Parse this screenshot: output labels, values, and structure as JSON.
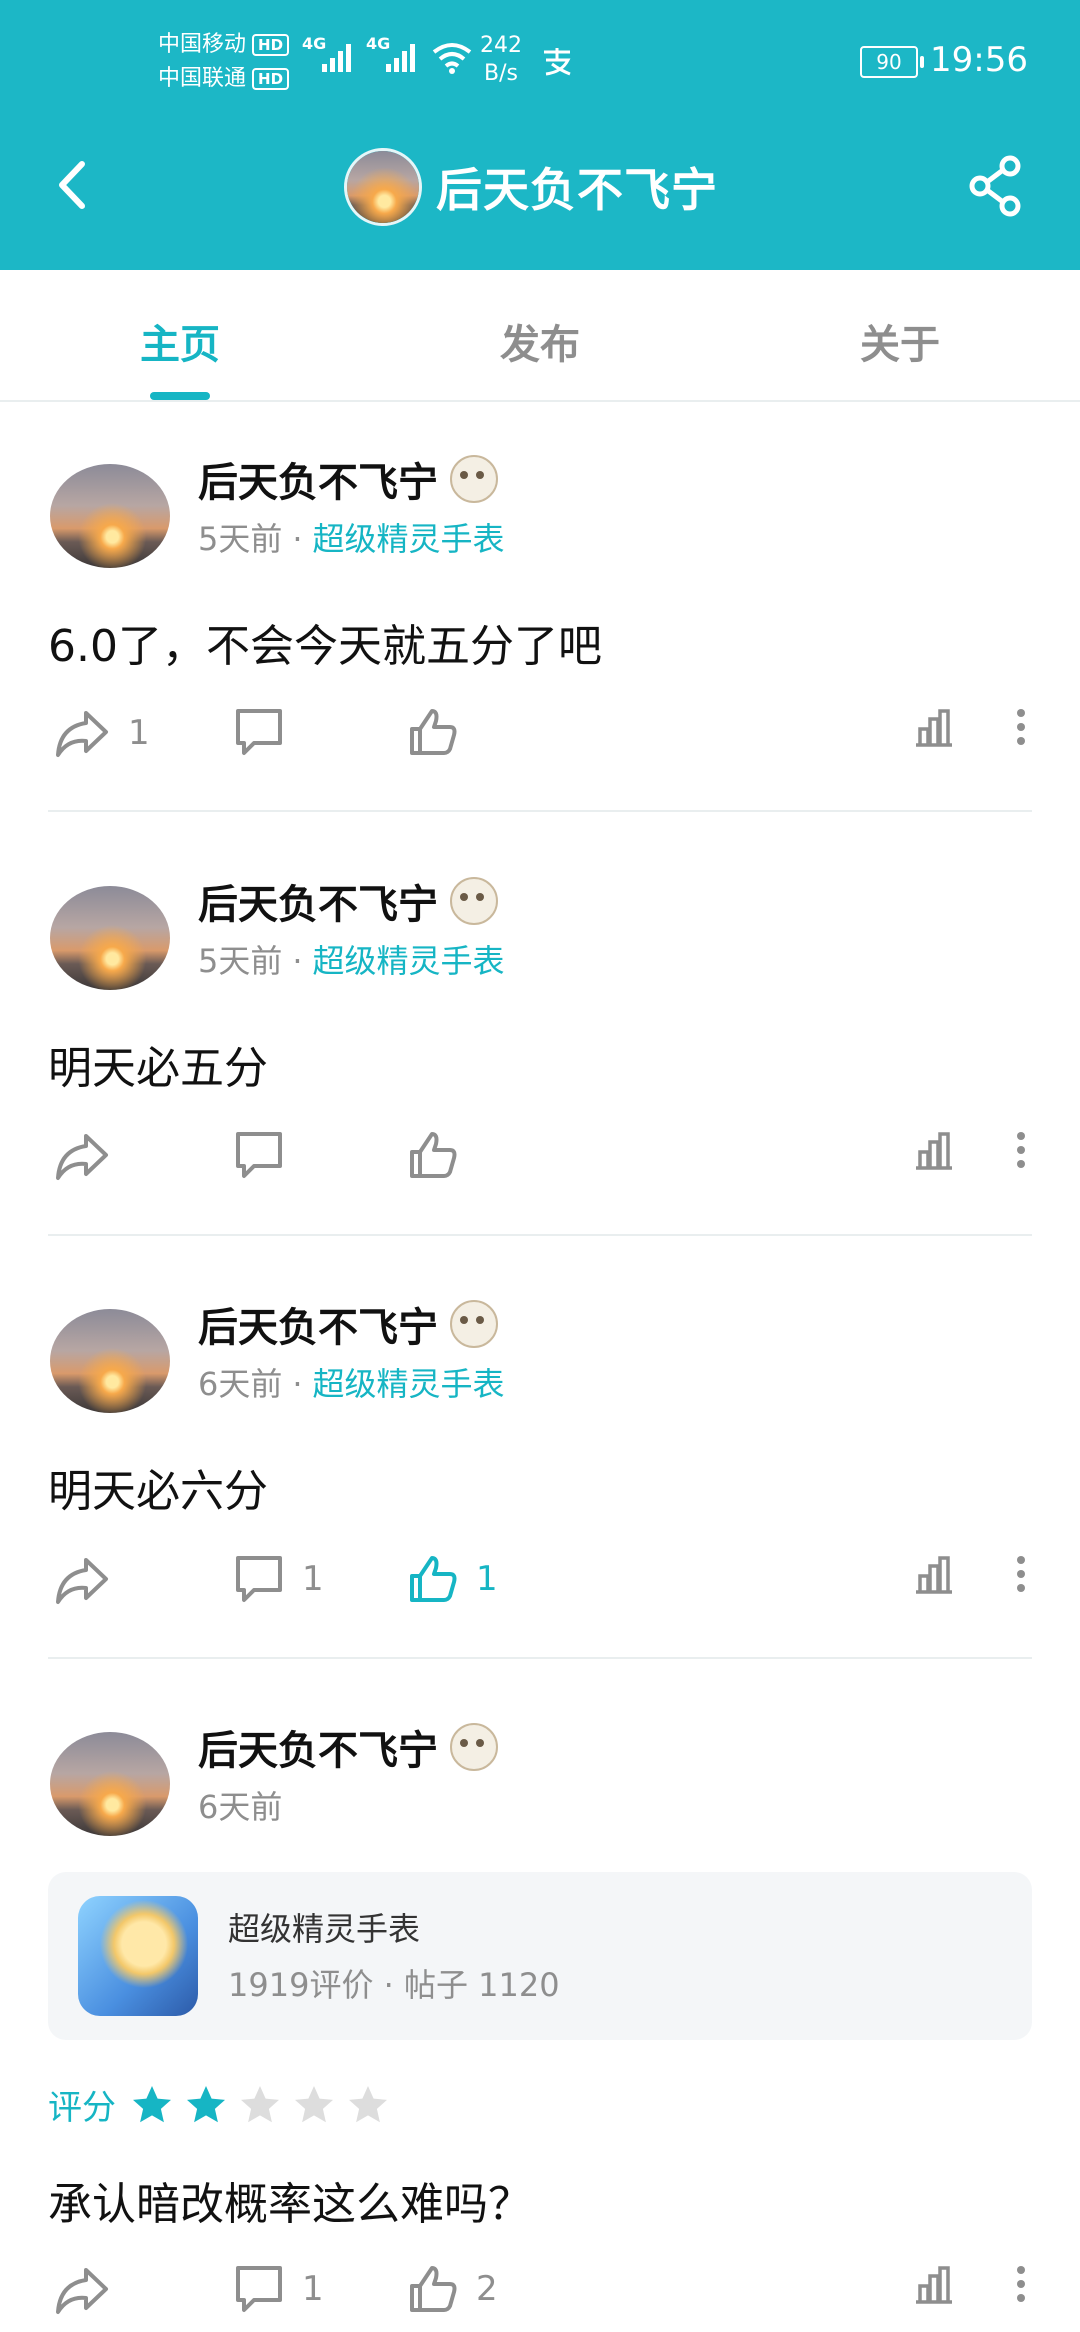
{
  "status_bar": {
    "carrier1": "中国移动",
    "carrier2": "中国联通",
    "hd_badge": "HD",
    "signal_type": "4G",
    "net_speed_value": "242",
    "net_speed_unit": "B/s",
    "battery": "90",
    "time": "19:56"
  },
  "header": {
    "title": "后天负不飞宁"
  },
  "tabs": [
    {
      "label": "主页",
      "active": true
    },
    {
      "label": "发布",
      "active": false
    },
    {
      "label": "关于",
      "active": false
    }
  ],
  "posts": [
    {
      "author": "后天负不飞宁",
      "time": "5天前",
      "separator": "·",
      "tag": "超级精灵手表",
      "content": "6.0了，不会今天就五分了吧",
      "share_count": "1",
      "comment_count": "",
      "like_count": ""
    },
    {
      "author": "后天负不飞宁",
      "time": "5天前",
      "separator": "·",
      "tag": "超级精灵手表",
      "content": "明天必五分",
      "share_count": "",
      "comment_count": "",
      "like_count": ""
    },
    {
      "author": "后天负不飞宁",
      "time": "6天前",
      "separator": "·",
      "tag": "超级精灵手表",
      "content": "明天必六分",
      "share_count": "",
      "comment_count": "1",
      "like_count": "1"
    },
    {
      "author": "后天负不飞宁",
      "time": "6天前",
      "content": "承认暗改概率这么难吗？",
      "share_count": "",
      "comment_count": "1",
      "like_count": "2",
      "game_card": {
        "title": "超级精灵手表",
        "stats": "1919评价 · 帖子 1120"
      },
      "rating": {
        "label": "评分",
        "stars": 2,
        "max": 5
      }
    }
  ],
  "colors": {
    "accent": "#16b5c4",
    "header_bg": "#1cb7c6",
    "muted": "#8e8e8e"
  },
  "icons": [
    "back-arrow-icon",
    "share-icon",
    "forward-icon",
    "comment-icon",
    "like-icon",
    "stats-icon",
    "more-icon",
    "star-icon"
  ]
}
